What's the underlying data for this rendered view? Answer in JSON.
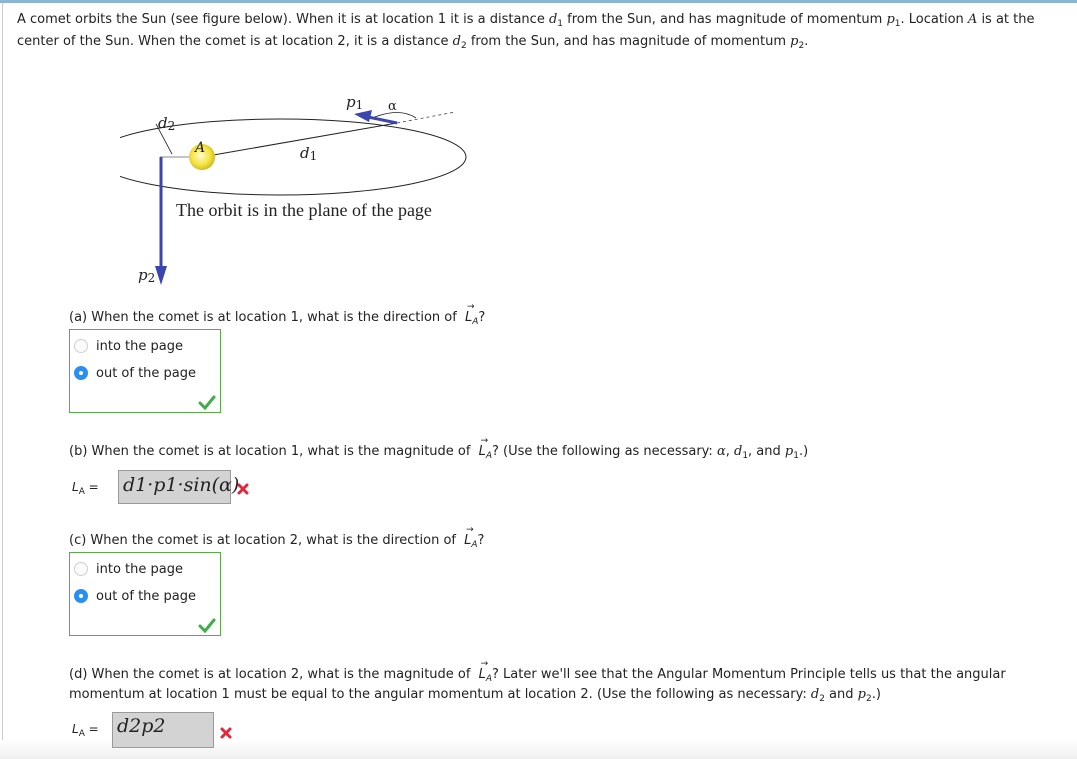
{
  "intro": {
    "s1": "A comet orbits the Sun (see figure below). When it is at location 1 it is a distance ",
    "d1_var": "d",
    "d1_sub": "1",
    "s2": " from the Sun, and has magnitude of momentum ",
    "p1_var": "p",
    "p1_sub": "1",
    "s3": ". Location ",
    "A_var": "A",
    "s4": " is at the center of the Sun. When the comet is at location 2, it is a distance ",
    "d2_var": "d",
    "d2_sub": "2",
    "s5": " from the Sun, and has magnitude of momentum ",
    "p2_var": "p",
    "p2_sub": "2",
    "s6": "."
  },
  "figure": {
    "caption": "The orbit is in the plane of the page",
    "labels": {
      "p1": "p",
      "p1_sub": "1",
      "alpha": "α",
      "d2": "d",
      "d2_sub": "2",
      "A": "A",
      "d1": "d",
      "d1_sub": "1",
      "p2": "p",
      "p2_sub": "2"
    },
    "colors": {
      "arrow": "#3a45b0",
      "sun": "#f2e23a",
      "orbit": "#222222"
    }
  },
  "vector": {
    "arrow": "→",
    "L": "L",
    "sub": "A"
  },
  "parts": {
    "a": {
      "question_pre": "(a) When the comet is at location 1, what is the direction of ",
      "question_post": "?",
      "options": [
        {
          "label": "into the page",
          "selected": false
        },
        {
          "label": "out of the page",
          "selected": true
        }
      ],
      "status": "correct"
    },
    "b": {
      "question_pre": "(b) When the comet is at location 1, what is the magnitude of ",
      "question_mid": "? (Use the following as necessary: ",
      "vars": [
        "α",
        "d1",
        "p1"
      ],
      "v1": "α",
      "sep1": ", ",
      "v2": "d",
      "v2sub": "1",
      "sep2": ", and ",
      "v3": "p",
      "v3sub": "1",
      "question_post": ".)",
      "answer_label": "L",
      "answer_label_sub": "A",
      "answer_eq": " =",
      "answer_value": "d1·p1·sin(α)",
      "status": "incorrect"
    },
    "c": {
      "question_pre": "(c) When the comet is at location 2, what is the direction of ",
      "question_post": "?",
      "options": [
        {
          "label": "into the page",
          "selected": false
        },
        {
          "label": "out of the page",
          "selected": true
        }
      ],
      "status": "correct"
    },
    "d": {
      "question_pre": "(d) When the comet is at location 2, what is the magnitude of ",
      "question_mid": "? Later we'll see that the Angular Momentum Principle tells us that the angular momentum at location 1 must be equal to the angular momentum at location 2. (Use the following as necessary: ",
      "v1": "d",
      "v1sub": "2",
      "sep1": " and ",
      "v2": "p",
      "v2sub": "2",
      "question_post": ".)",
      "answer_label": "L",
      "answer_label_sub": "A",
      "answer_eq": " =",
      "answer_value": "d2p2",
      "status": "incorrect"
    }
  },
  "colors": {
    "correct": "#3fae49",
    "incorrect": "#e0283a",
    "radio_selected": "#2b8ff2",
    "choice_border": "#5aaa4a",
    "answer_box": "#d3d3d3"
  }
}
